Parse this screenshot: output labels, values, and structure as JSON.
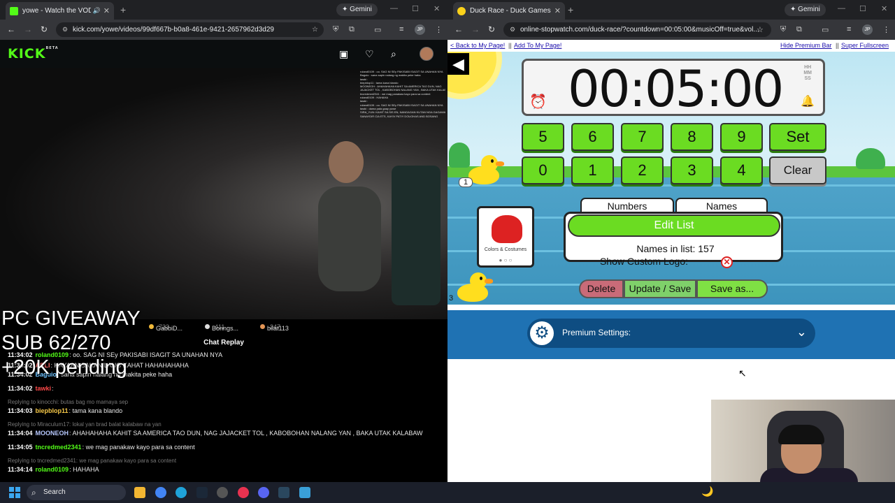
{
  "left_browser": {
    "tab_title": "yowe - Watch the VOD on Kick",
    "url": "kick.com/yowe/videos/99df667b-b0a8-461e-9421-2657962d3d29",
    "gemini_label": "Gemini",
    "profile_initials": "JP"
  },
  "kick": {
    "logo": "KICK",
    "logo_beta": "BETA",
    "video_chat_lines": [
      "roland0109 : oo. SAG NI SEy PAKISABI ISAGIT SA UNAHAN NYA",
      "Baguio : sana sapin nalang ng makita peke haha",
      "tawki :",
      "biepblop11 : tama kana blando",
      "MOONEOH : AHAHAHAHA KAHIT SA AMERICA TAO DUN, NAG",
      "JAJACKET TOL , KABOBOHAN NALANG YAN , BAKA UTAK KALABAW",
      "tncredmed2341 : we mag panakaw kayo para sa content",
      "roland0109 : HAHAHA",
      "tawki :",
      "roland0109 : oo. SAG NI SEy PAKISABI ISAGIT SA UNAHAN NYA",
      "tawki : dama pala gaay yowe",
      "SIRA_YUN: KAHIT SA SIS EN, NANGAGAN KUTAN NGA GAGAWA",
      "SANAYDIR CIA ETS, KAYIV PATIY DOUGHAS AND BOSANG"
    ],
    "gifters": [
      {
        "name": "GabbiD...",
        "count": "733"
      },
      {
        "name": "Bonngs...",
        "count": "411"
      },
      {
        "name": "bilat113",
        "count": "347"
      }
    ],
    "chat_header": "Chat Replay",
    "overlay_lines": [
      "PC GIVEAWAY",
      "SUB 62/270",
      "+20K pending"
    ],
    "chat": [
      {
        "time": "11:34:02",
        "user": "roland0109",
        "color": "#53fc18",
        "text": ": oo. SAG NI SEy PAKISABI ISAGIT SA UNAHAN NYA"
      },
      {
        "time": "11:34:02",
        "user": "ARLI",
        "color": "#ff6b6b",
        "text": ": HAYAAN SAKANILANG KAHAT HAHAHAHAHA"
      },
      {
        "time": "11:34:02",
        "user": "Baguio",
        "color": "#6fc3ff",
        "text": ": sana sapin nalang ng makita peke haha"
      },
      {
        "time": "11:34:02",
        "user": "tawki",
        "color": "#ff4848",
        "text": ":"
      },
      {
        "reply": "Replying to kinocchi: butas bag mo mamaya sep"
      },
      {
        "time": "11:34:03",
        "user": "biepblop11",
        "color": "#f7c948",
        "text": ": tama kana blando"
      },
      {
        "reply": "Replying to Miraculum17: lokal yan brad balat kalabaw na yan"
      },
      {
        "time": "11:34:04",
        "user": "MOONEOH",
        "color": "#b8c9ff",
        "text": ": AHAHAHAHA KAHIT SA AMERICA TAO DUN, NAG JAJACKET TOL , KABOBOHAN NALANG YAN , BAKA UTAK KALABAW"
      },
      {
        "time": "11:34:05",
        "user": "tncredmed2341",
        "color": "#53fc18",
        "text": ": we mag panakaw kayo para sa content"
      },
      {
        "reply": "Replying to tncredmed2341: we mag panakaw kayo para sa content"
      },
      {
        "time": "11:34:14",
        "user": "roland0109",
        "color": "#53fc18",
        "text": ": HAHAHA"
      }
    ]
  },
  "right_browser": {
    "tab_title": "Duck Race - Duck Games",
    "url": "online-stopwatch.com/duck-race/?countdown=00:05:00&musicOff=true&vol...",
    "gemini_label": "Gemini",
    "profile_initials": "JP"
  },
  "duckrace": {
    "links": {
      "back": "< Back to My Page!",
      "sep1": "||",
      "add": "Add To My Page!",
      "hide": "Hide Premium Bar",
      "sep2": "||",
      "full": "Super Fullscreen"
    },
    "timer": "00:05:00",
    "hms": [
      "HH",
      "MM",
      "SS"
    ],
    "keypad_row1": [
      "5",
      "6",
      "7",
      "8",
      "9",
      "Set"
    ],
    "keypad_row2": [
      "0",
      "1",
      "2",
      "3",
      "4",
      "Clear"
    ],
    "duck_labels": [
      "1",
      "3"
    ],
    "tabs": [
      "Numbers",
      "Names"
    ],
    "active_tab": "Names",
    "edit_list": "Edit List",
    "names_in_list": "Names in list: 157",
    "show_custom_logo": "Show Custom Logo:",
    "logo_caption": "Colors & Costumes",
    "logo_dots": "● ○ ○",
    "buttons": [
      "Delete",
      "Update / Save",
      "Save as..."
    ],
    "premium_settings": "Premium Settings:"
  },
  "taskbar": {
    "search_placeholder": "Search"
  },
  "colors": {
    "kick_green": "#53fc18",
    "keypad_green": "#6bdc22",
    "premium_blue": "#1f72b3"
  }
}
